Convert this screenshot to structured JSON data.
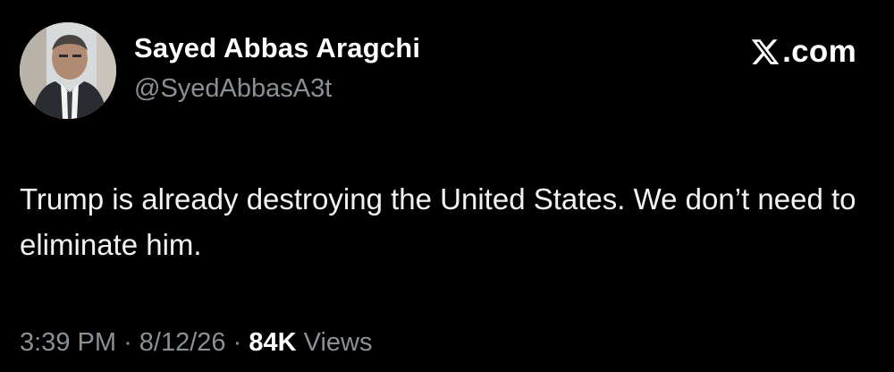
{
  "tweet": {
    "author": {
      "display_name": "Sayed Abbas Aragchi",
      "handle": "@SyedAbbasA3t",
      "avatar_icon": "profile-photo"
    },
    "source": {
      "brand_icon": "x-logo-icon",
      "domain_suffix": ".com"
    },
    "text": "Trump is already destroying the United States. We don’t need to eliminate him.",
    "meta": {
      "time": "3:39 PM",
      "separator": "·",
      "date": "8/12/26",
      "views_count": "84K",
      "views_label": "Views"
    }
  },
  "colors": {
    "background": "#000000",
    "primary_text": "#ffffff",
    "secondary_text": "#8b9096"
  }
}
